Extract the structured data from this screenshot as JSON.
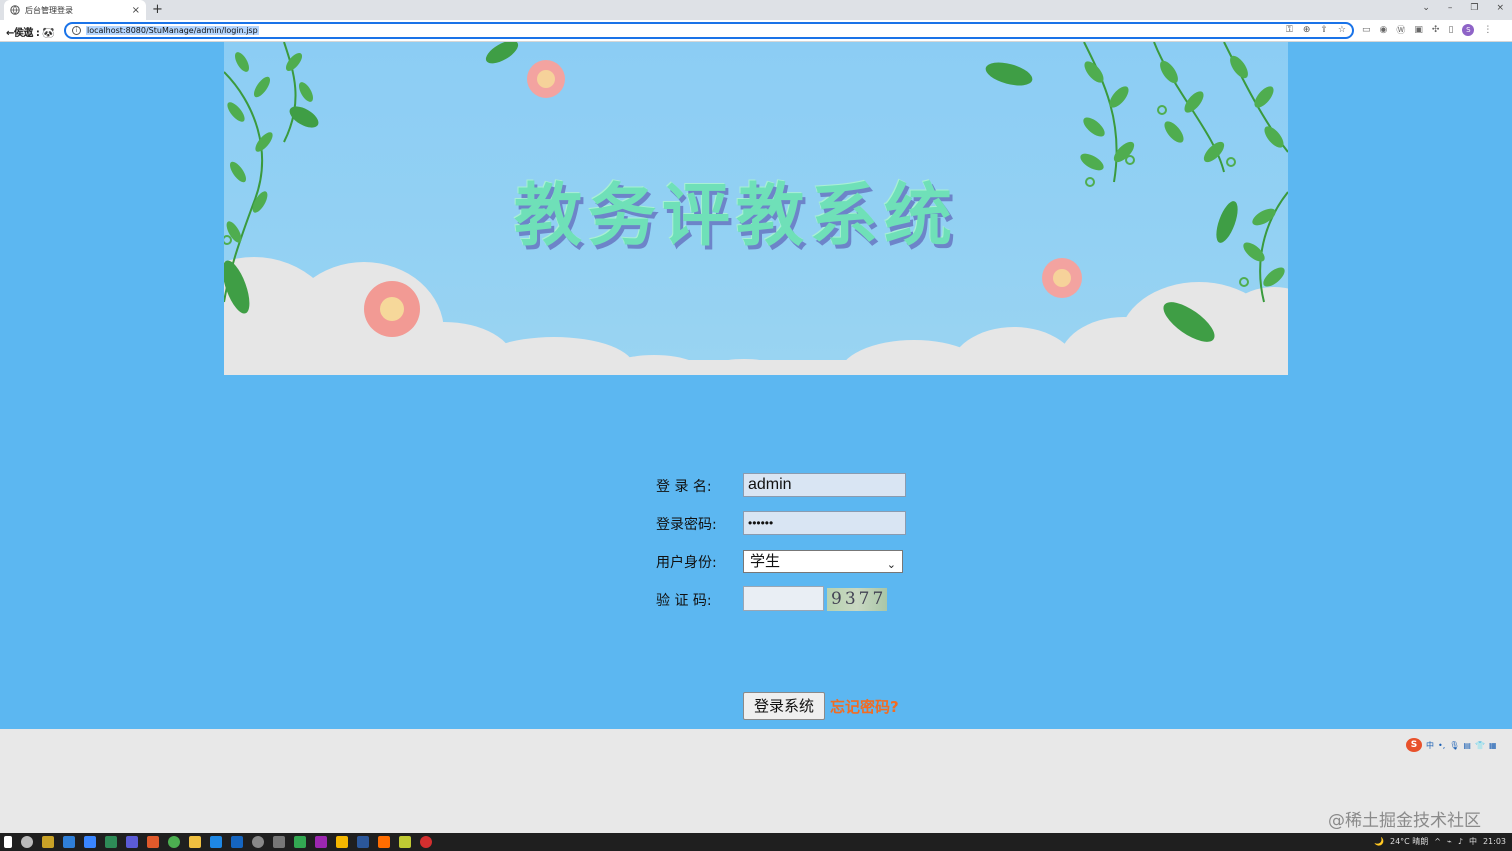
{
  "browser": {
    "tab_title": "后台管理登录",
    "tab_close": "×",
    "new_tab": "+",
    "nav_text": "←侯遨 : 🐼",
    "url": "localhost:8080/StuManage/admin/login.jsp",
    "window_controls": [
      "⌄",
      "–",
      "❐",
      "×"
    ]
  },
  "banner": {
    "title": "教务评教系统"
  },
  "form": {
    "username_label": "登 录 名:",
    "username_value": "admin",
    "password_label": "登录密码:",
    "password_value": "••••••",
    "role_label": "用户身份:",
    "role_selected": "学生",
    "captcha_label": "验 证 码:",
    "captcha_input_value": "",
    "captcha_image_text": "9377",
    "submit_label": "登录系统",
    "forgot_label": "忘记密码?"
  },
  "ime": {
    "logo": "S",
    "lang": "中"
  },
  "watermark": "@稀土掘金技术社区",
  "taskbar": {
    "weather": "24°C 晴朗",
    "ime_lang": "中",
    "clock": "21:03"
  },
  "colors": {
    "page_bg": "#5cb7f1",
    "banner_bg": "#8ccdf4",
    "forgot_link": "#f26c22",
    "input_bg": "#d9e5f3"
  }
}
